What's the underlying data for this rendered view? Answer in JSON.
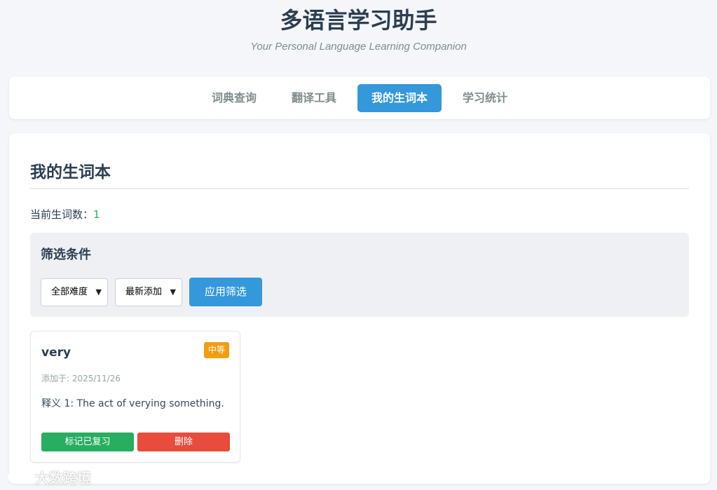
{
  "app": {
    "title": "多语言学习助手",
    "subtitle": "Your Personal Language Learning Companion"
  },
  "nav": {
    "tabs": [
      {
        "label": "词典查询",
        "active": false
      },
      {
        "label": "翻译工具",
        "active": false
      },
      {
        "label": "我的生词本",
        "active": true
      },
      {
        "label": "学习统计",
        "active": false
      }
    ]
  },
  "vocab": {
    "title": "我的生词本",
    "count_label": "当前生词数：",
    "count_value": "1",
    "filter": {
      "title": "筛选条件",
      "difficulty_selected": "全部难度",
      "sort_selected": "最新添加",
      "apply_label": "应用筛选"
    },
    "words": [
      {
        "word": "very",
        "difficulty": "中等",
        "added": "添加于: 2025/11/26",
        "definition": "释义 1: The act of verying something.",
        "review_label": "标记已复习",
        "delete_label": "删除"
      }
    ]
  },
  "watermark": {
    "text": "大数跨境"
  },
  "colors": {
    "primary": "#3498db",
    "success": "#27ae60",
    "danger": "#e74c3c",
    "warning": "#f39c12",
    "text": "#2c3e50"
  }
}
